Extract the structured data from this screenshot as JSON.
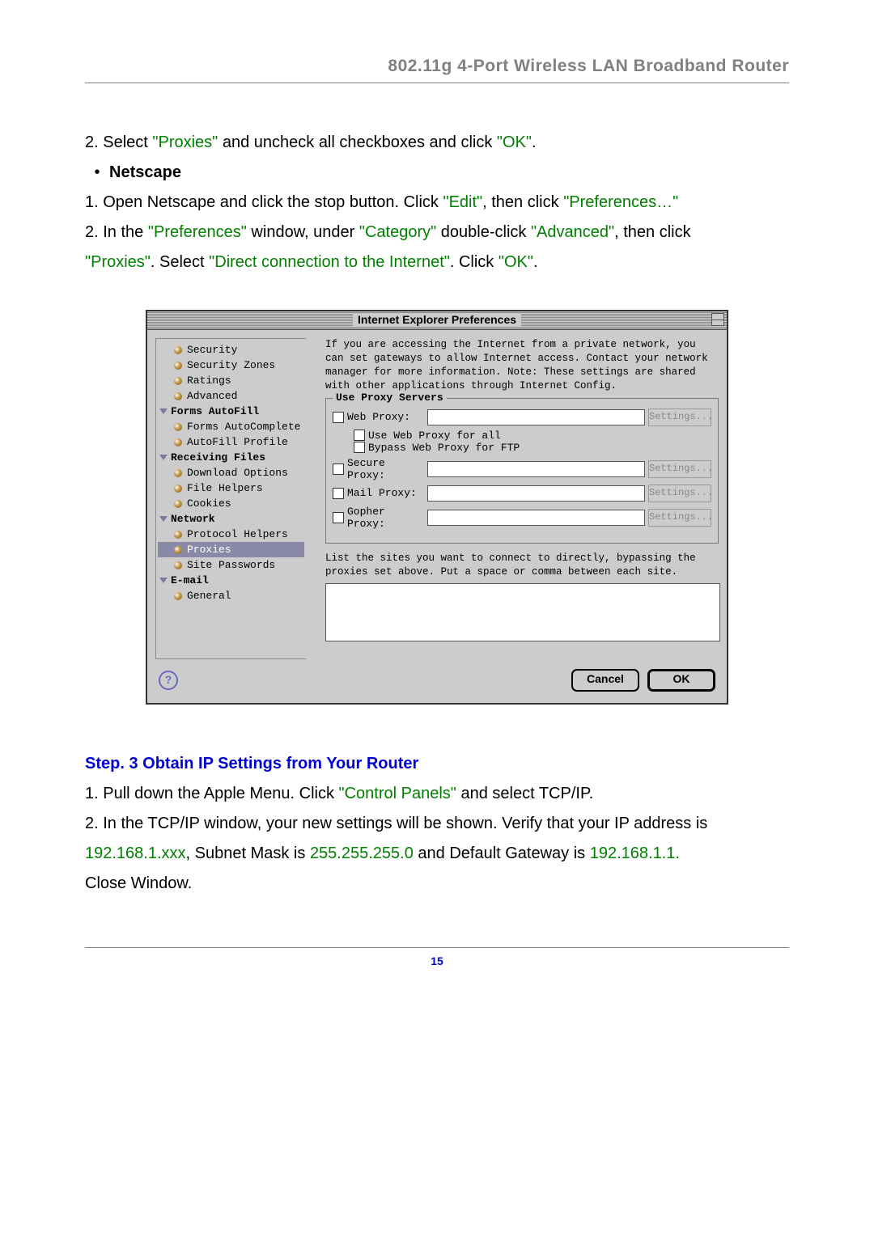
{
  "header": {
    "title": "802.11g 4-Port Wireless LAN Broadband Router"
  },
  "intro_line": {
    "prefix": "2. Select ",
    "q1": "\"Proxies\"",
    "mid": " and uncheck all checkboxes and click ",
    "q2": "\"OK\"",
    "suffix": "."
  },
  "netscape": {
    "bullet_label": "Netscape",
    "line1": {
      "a": "1. Open Netscape and click the stop button. Click ",
      "b": "\"Edit\"",
      "c": ", then click ",
      "d": "\"Preferences…\""
    },
    "line2": {
      "a": "2. In the ",
      "b": "\"Preferences\"",
      "c": " window, under ",
      "d": "\"Category\"",
      "e": " double-click ",
      "f": "\"Advanced\"",
      "g": ", then click"
    },
    "line3": {
      "a": "\"Proxies\"",
      "b": ". Select ",
      "c": "\"Direct connection to the Internet\"",
      "d": ". Click ",
      "e": "\"OK\"",
      "f": "."
    }
  },
  "dialog": {
    "title": "Internet Explorer Preferences",
    "tree": {
      "items_top": [
        "Security",
        "Security Zones",
        "Ratings",
        "Advanced"
      ],
      "group_forms": "Forms AutoFill",
      "items_forms": [
        "Forms AutoComplete",
        "AutoFill Profile"
      ],
      "group_recv": "Receiving Files",
      "items_recv": [
        "Download Options",
        "File Helpers",
        "Cookies"
      ],
      "group_net": "Network",
      "items_net": [
        "Protocol Helpers",
        "Proxies",
        "Site Passwords"
      ],
      "selected": "Proxies",
      "group_email": "E-mail",
      "items_email": [
        "General"
      ]
    },
    "intro": "If you are accessing the Internet from a private network, you can set gateways to allow Internet access. Contact your network manager for more information. Note: These settings are shared with other applications through Internet Config.",
    "proxy_legend": "Use Proxy Servers",
    "web_proxy": "Web Proxy:",
    "use_web_all": "Use Web Proxy for all",
    "bypass_ftp": "Bypass Web Proxy for FTP",
    "secure_proxy": "Secure Proxy:",
    "mail_proxy": "Mail Proxy:",
    "gopher_proxy": "Gopher Proxy:",
    "settings_label": "Settings...",
    "bypass_text": "List the sites you want to connect to directly, bypassing the proxies set above. Put a space or comma between each site.",
    "cancel": "Cancel",
    "ok": "OK",
    "help": "?"
  },
  "step3": {
    "heading": "Step. 3 Obtain IP Settings from Your Router",
    "line1": {
      "a": "1. Pull down the Apple Menu. Click ",
      "b": "\"Control Panels\"",
      "c": " and select TCP/IP."
    },
    "line2": "2. In the TCP/IP window, your new settings will be shown. Verify that your IP address is",
    "line3": {
      "a": "192.168.1.xxx",
      "b": ", Subnet Mask is ",
      "c": "255.255.255.0",
      "d": " and Default Gateway is ",
      "e": "192.168.1.1."
    },
    "line4": "Close Window."
  },
  "page_number": "15"
}
